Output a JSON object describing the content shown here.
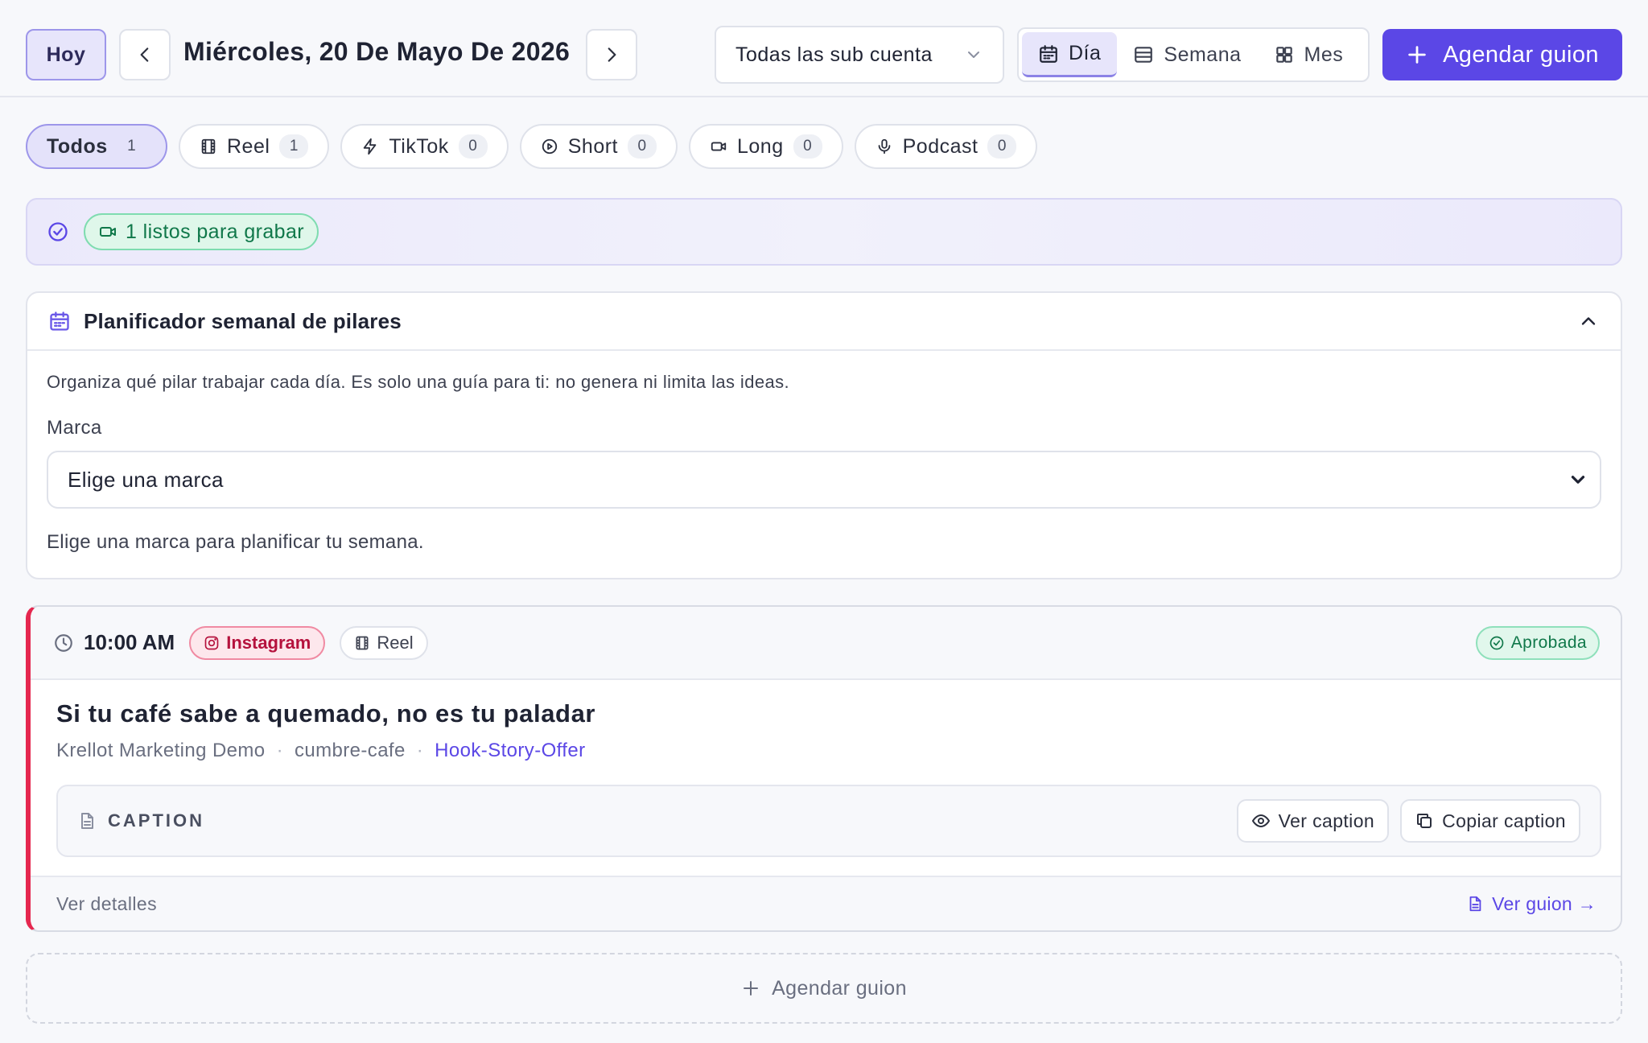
{
  "header": {
    "today_label": "Hoy",
    "date_title": "Miércoles, 20 De Mayo De 2026",
    "account_select": "Todas las sub cuenta",
    "views": [
      {
        "label": "Día",
        "icon": "calendar-icon",
        "active": true
      },
      {
        "label": "Semana",
        "icon": "list-icon",
        "active": false
      },
      {
        "label": "Mes",
        "icon": "grid-icon",
        "active": false
      }
    ],
    "schedule_button": "Agendar guion"
  },
  "filters": [
    {
      "label": "Todos",
      "count": "1",
      "active": true
    },
    {
      "label": "Reel",
      "count": "1",
      "icon": "film-icon"
    },
    {
      "label": "TikTok",
      "count": "0",
      "icon": "bolt-icon"
    },
    {
      "label": "Short",
      "count": "0",
      "icon": "play-circle-icon"
    },
    {
      "label": "Long",
      "count": "0",
      "icon": "video-icon"
    },
    {
      "label": "Podcast",
      "count": "0",
      "icon": "mic-icon"
    }
  ],
  "ready_banner": {
    "text": "1 listos para grabar"
  },
  "planner": {
    "title": "Planificador semanal de pilares",
    "description": "Organiza qué pilar trabajar cada día. Es solo una guía para ti: no genera ni limita las ideas.",
    "brand_label": "Marca",
    "brand_select": "Elige una marca",
    "hint": "Elige una marca para planificar tu semana."
  },
  "event": {
    "time": "10:00 AM",
    "platform": "Instagram",
    "format": "Reel",
    "status": "Aprobada",
    "title": "Si tu café sabe a quemado, no es tu paladar",
    "account": "Krellot Marketing Demo",
    "brand": "cumbre-cafe",
    "formula": "Hook-Story-Offer",
    "caption_label": "CAPTION",
    "view_caption": "Ver caption",
    "copy_caption": "Copiar caption",
    "details": "Ver detalles",
    "view_script": "Ver guion →"
  },
  "add_script": "Agendar guion",
  "colors": {
    "accent": "#5b47e6",
    "instagram": "#e5274f",
    "success": "#10784a"
  }
}
